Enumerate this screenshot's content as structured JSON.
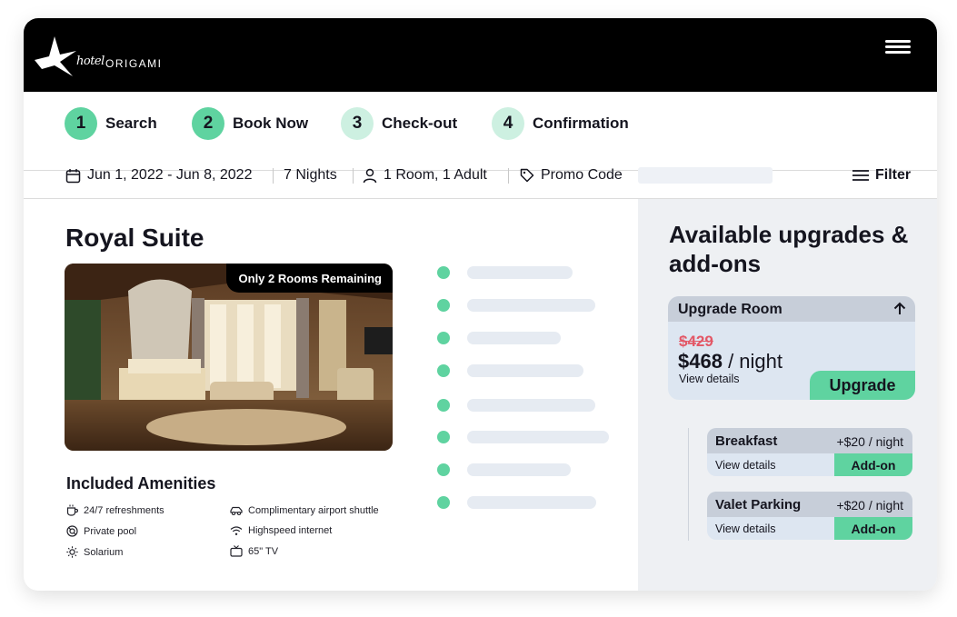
{
  "brand": {
    "script": "hotel",
    "name": "ORIGAMI"
  },
  "steps": [
    {
      "number": "1",
      "label": "Search",
      "state": "done"
    },
    {
      "number": "2",
      "label": "Book Now",
      "state": "done"
    },
    {
      "number": "3",
      "label": "Check-out",
      "state": "todo"
    },
    {
      "number": "4",
      "label": "Confirmation",
      "state": "todo"
    }
  ],
  "search": {
    "dates": "Jun 1, 2022 - Jun 8, 2022",
    "nights": "7 Nights",
    "guests": "1 Room, 1 Adult",
    "promo_label": "Promo Code",
    "promo_value": "",
    "filter_label": "Filter"
  },
  "room": {
    "title": "Royal Suite",
    "badge": "Only 2 Rooms Remaining",
    "amenities_title": "Included Amenities",
    "amenities": [
      {
        "label": "24/7 refreshments",
        "icon": "coffee-cup-icon"
      },
      {
        "label": "Private pool",
        "icon": "pool-ring-icon"
      },
      {
        "label": "Solarium",
        "icon": "sun-icon"
      },
      {
        "label": "Complimentary airport shuttle",
        "icon": "car-icon"
      },
      {
        "label": "Highspeed internet",
        "icon": "wifi-icon"
      },
      {
        "label": "65\" TV",
        "icon": "tv-icon"
      }
    ]
  },
  "upgrades": {
    "title": "Available upgrades & add-ons",
    "upgrade_room": {
      "label": "Upgrade Room",
      "old_price": "$429",
      "new_price": "$468",
      "per": "/ night",
      "details": "View details",
      "button": "Upgrade"
    },
    "addons": [
      {
        "name": "Breakfast",
        "price": "+$20 / night",
        "details": "View details",
        "button": "Add-on"
      },
      {
        "name": "Valet Parking",
        "price": "+$20 / night",
        "details": "View details",
        "button": "Add-on"
      }
    ]
  },
  "colors": {
    "accent": "#5fd3a0",
    "accent_light": "#cdf0e1",
    "strike_price": "#e35766",
    "header": "#000000",
    "panel": "#eef0f3"
  }
}
